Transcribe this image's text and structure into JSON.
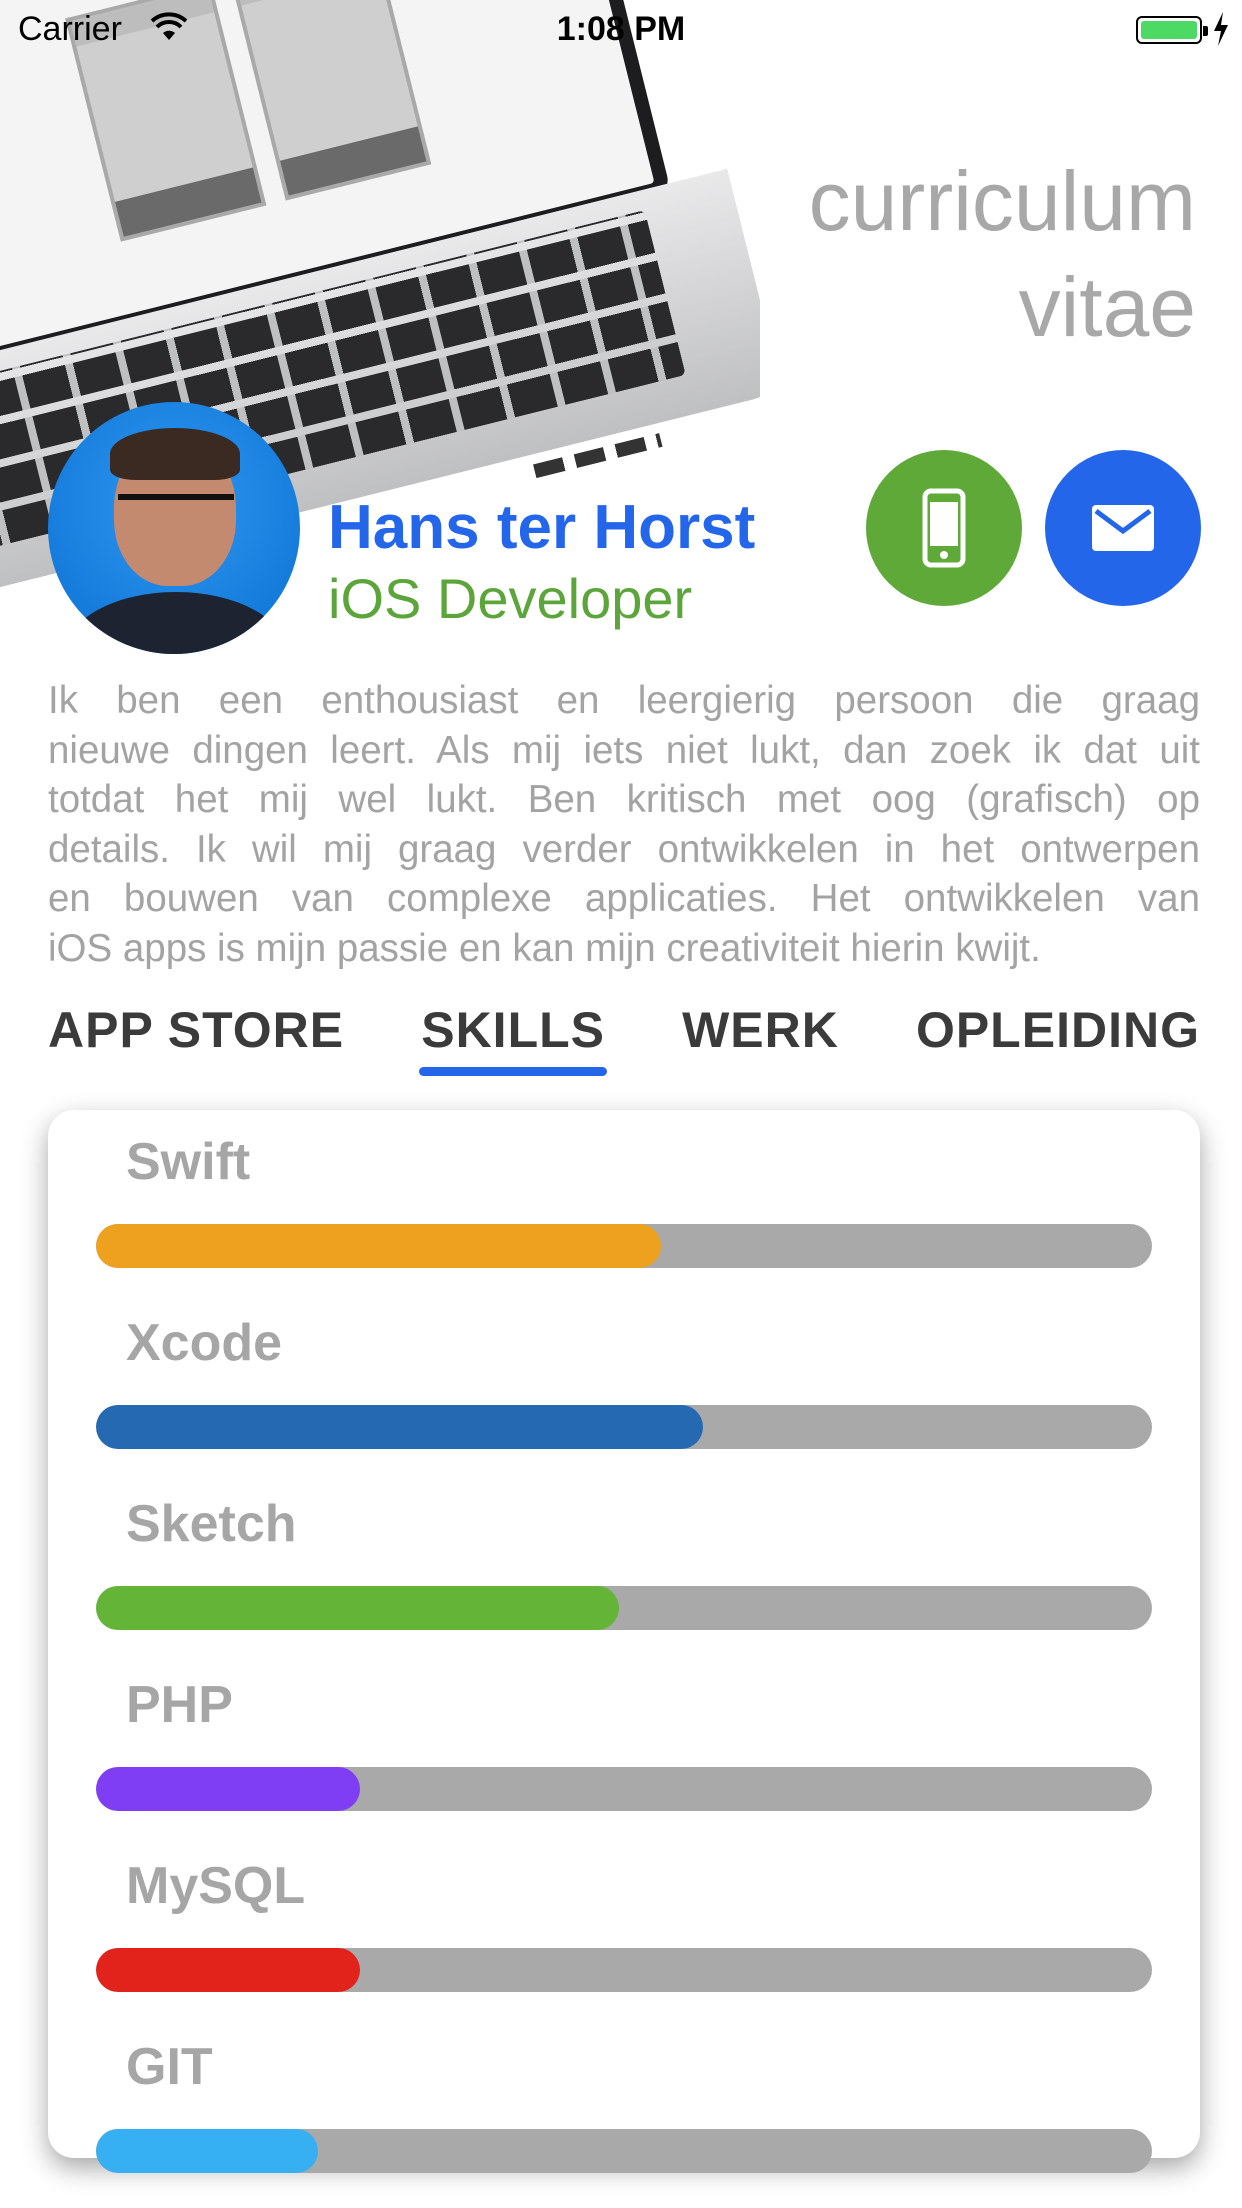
{
  "status_bar": {
    "carrier": "Carrier",
    "time": "1:08 PM",
    "icons": [
      "wifi-icon",
      "battery-icon",
      "charging-bolt-icon"
    ]
  },
  "header": {
    "title_line1": "curriculum",
    "title_line2": "vitae"
  },
  "profile": {
    "name": "Hans ter Horst",
    "role": "iOS Developer",
    "name_color": "#2466ea",
    "role_color": "#5ba53a"
  },
  "actions": {
    "phone_icon": "phone-icon",
    "mail_icon": "mail-icon",
    "phone_color": "#5ea938",
    "mail_color": "#2466ea"
  },
  "bio": {
    "lines": [
      "Ik ben een enthousiast en leergierig persoon die graag",
      "nieuwe dingen leert. Als mij iets niet lukt, dan zoek ik dat uit",
      "totdat het mij wel lukt. Ben kritisch met oog (grafisch) op",
      "details. Ik wil mij graag verder ontwikkelen in het ontwerpen",
      "en bouwen van complexe applicaties. Het ontwikkelen van",
      "iOS apps is mijn passie en kan mijn creativiteit hierin kwijt."
    ]
  },
  "tabs": [
    {
      "label": "APP STORE",
      "active": false
    },
    {
      "label": "SKILLS",
      "active": true
    },
    {
      "label": "WERK",
      "active": false
    },
    {
      "label": "OPLEIDING",
      "active": false
    }
  ],
  "skills": [
    {
      "name": "Swift",
      "level": 0.535,
      "color": "#eea11f"
    },
    {
      "name": "Xcode",
      "level": 0.575,
      "color": "#2469b2"
    },
    {
      "name": "Sketch",
      "level": 0.495,
      "color": "#64b437"
    },
    {
      "name": "PHP",
      "level": 0.25,
      "color": "#7f3ef4"
    },
    {
      "name": "MySQL",
      "level": 0.25,
      "color": "#e1231c"
    },
    {
      "name": "GIT",
      "level": 0.21,
      "color": "#36b0f2"
    }
  ]
}
